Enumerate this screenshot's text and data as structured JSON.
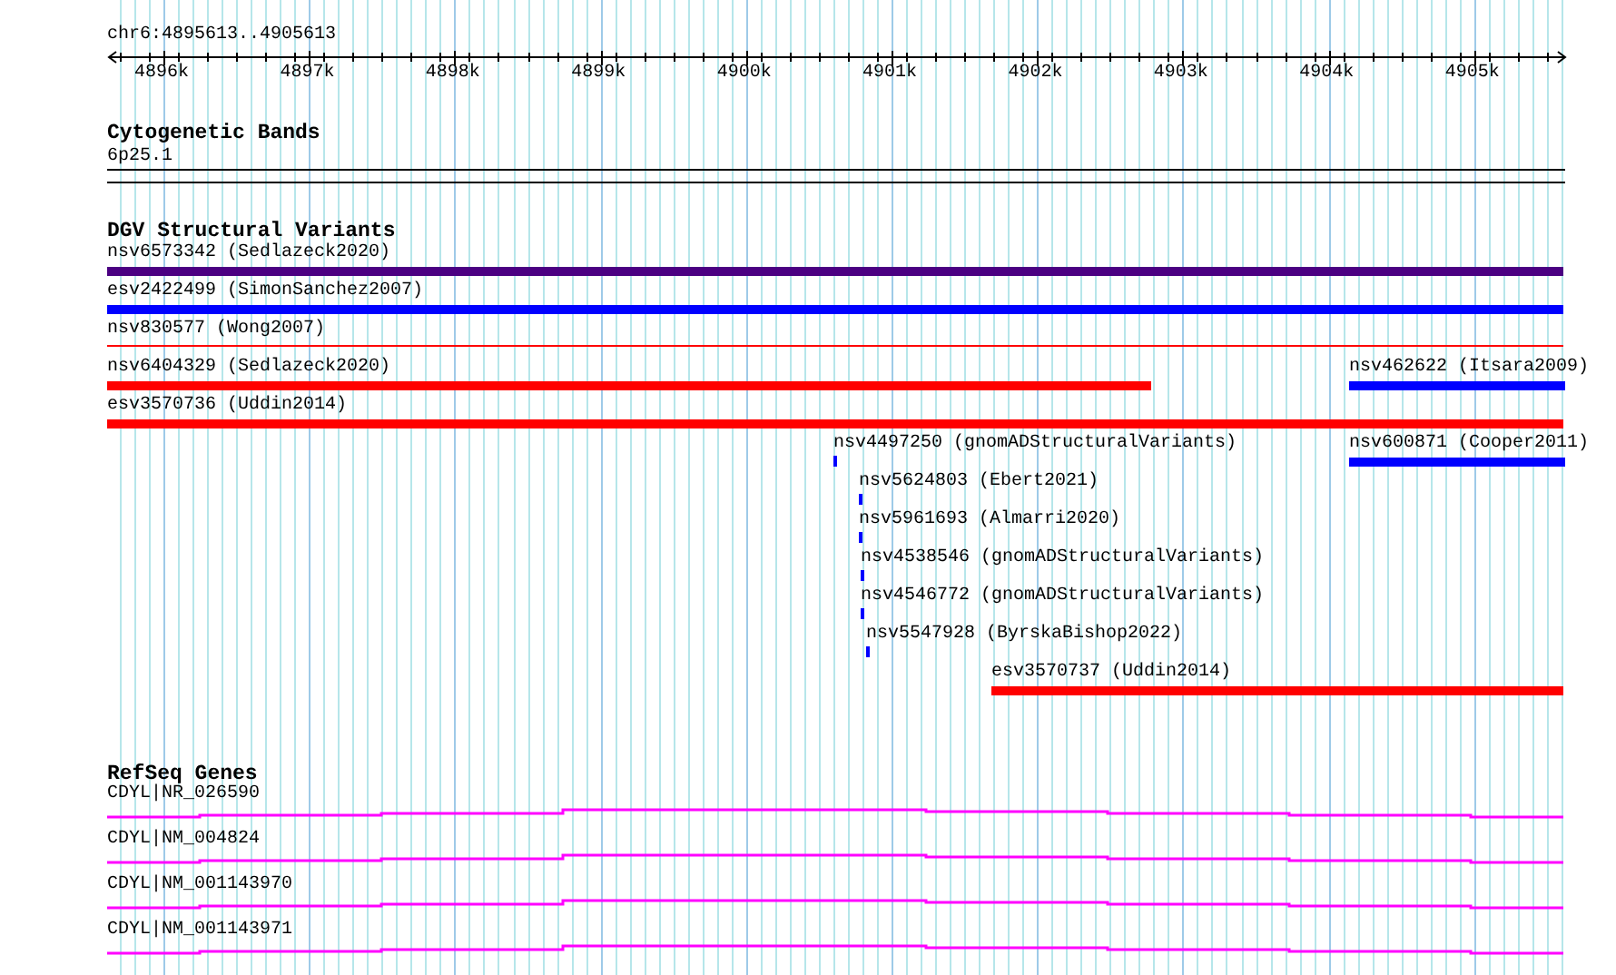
{
  "region": "chr6:4895613..4905613",
  "ruler": {
    "ticks": [
      "4896k",
      "4897k",
      "4898k",
      "4899k",
      "4900k",
      "4901k",
      "4902k",
      "4903k",
      "4904k",
      "4905k"
    ]
  },
  "tracks": [
    {
      "title": "Cytogenetic Bands",
      "kind": "bands",
      "features": [
        {
          "label": "6p25.1"
        }
      ]
    },
    {
      "title": "DGV Structural Variants",
      "kind": "variants",
      "features": [
        {
          "label": "nsv6573342 (Sedlazeck2020)",
          "color": "#4b0082"
        },
        {
          "label": "esv2422499 (SimonSanchez2007)",
          "color": "#0000ff"
        },
        {
          "label": "nsv830577 (Wong2007)",
          "color": "#ff0000"
        },
        {
          "label": "nsv6404329 (Sedlazeck2020)",
          "color": "#ff0000"
        },
        {
          "label": "nsv462622 (Itsara2009)",
          "color": "#0000ff"
        },
        {
          "label": "esv3570736 (Uddin2014)",
          "color": "#ff0000"
        },
        {
          "label": "nsv4497250 (gnomADStructuralVariants)",
          "color": "#0000ff"
        },
        {
          "label": "nsv600871 (Cooper2011)",
          "color": "#0000ff"
        },
        {
          "label": "nsv5624803 (Ebert2021)",
          "color": "#0000ff"
        },
        {
          "label": "nsv5961693 (Almarri2020)",
          "color": "#0000ff"
        },
        {
          "label": "nsv4538546 (gnomADStructuralVariants)",
          "color": "#0000ff"
        },
        {
          "label": "nsv4546772 (gnomADStructuralVariants)",
          "color": "#0000ff"
        },
        {
          "label": "nsv5547928 (ByrskaBishop2022)",
          "color": "#0000ff"
        },
        {
          "label": "esv3570737 (Uddin2014)",
          "color": "#ff0000"
        }
      ]
    },
    {
      "title": "RefSeq Genes",
      "kind": "genes",
      "features": [
        {
          "label": "CDYL|NR_026590"
        },
        {
          "label": "CDYL|NM_004824"
        },
        {
          "label": "CDYL|NM_001143970"
        },
        {
          "label": "CDYL|NM_001143971"
        }
      ]
    }
  ]
}
